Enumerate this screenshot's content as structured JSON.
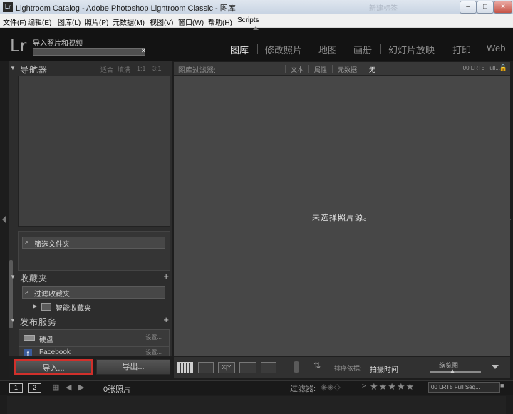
{
  "window": {
    "title": "Lightroom Catalog - Adobe Photoshop Lightroom Classic - 图库",
    "app_icon": "Lr",
    "ghost_tab": "新建标签",
    "buttons": {
      "minimize": "–",
      "maximize": "□",
      "close": "×"
    }
  },
  "menubar": [
    "文件(F)",
    "编辑(E)",
    "图库(L)",
    "照片(P)",
    "元数据(M)",
    "视图(V)",
    "窗口(W)",
    "帮助(H)",
    "Scripts"
  ],
  "identity": {
    "logo": "Lr",
    "task_title": "导入照片和视频",
    "cancel": "×"
  },
  "modules": [
    {
      "label": "图库",
      "active": true
    },
    {
      "label": "修改照片",
      "active": false
    },
    {
      "label": "地图",
      "active": false
    },
    {
      "label": "画册",
      "active": false
    },
    {
      "label": "幻灯片放映",
      "active": false
    },
    {
      "label": "打印",
      "active": false
    },
    {
      "label": "Web",
      "active": false
    }
  ],
  "left_panel": {
    "navigator": {
      "title": "导航器",
      "zoom_options": [
        "适合",
        "填满",
        "1:1",
        "3:1"
      ]
    },
    "folders_filter": "筛选文件夹",
    "collections": {
      "title": "收藏夹",
      "filter": "过滤收藏夹",
      "item": "智能收藏夹"
    },
    "publish": {
      "title": "发布服务",
      "services": [
        {
          "name": "硬盘",
          "setup": "设置..."
        },
        {
          "name": "Facebook",
          "setup": "设置..."
        }
      ]
    },
    "import_button": "导入...",
    "export_button": "导出..."
  },
  "filter_bar": {
    "label": "图库过滤器:",
    "options": [
      "文本",
      "属性",
      "元数据",
      "无"
    ],
    "active": "无",
    "preset": "00 LRT5 Full..."
  },
  "main": {
    "empty_message": "未选择照片源。"
  },
  "toolbar": {
    "sort_label": "排序依据:",
    "sort_value": "拍摄时间",
    "thumb_label": "缩览图",
    "thumb_size": 0.45
  },
  "filmstrip": {
    "pages": [
      "1",
      "2"
    ],
    "count": "0张照片",
    "filter_label": "过滤器:",
    "rating_op": "≥",
    "stars": "★★★★★",
    "preset": "00 LRT5 Full Seq..."
  },
  "colors": {
    "accent_red": "#d1302b",
    "panel_bg": "#2d2d2d",
    "main_bg": "#474747"
  }
}
